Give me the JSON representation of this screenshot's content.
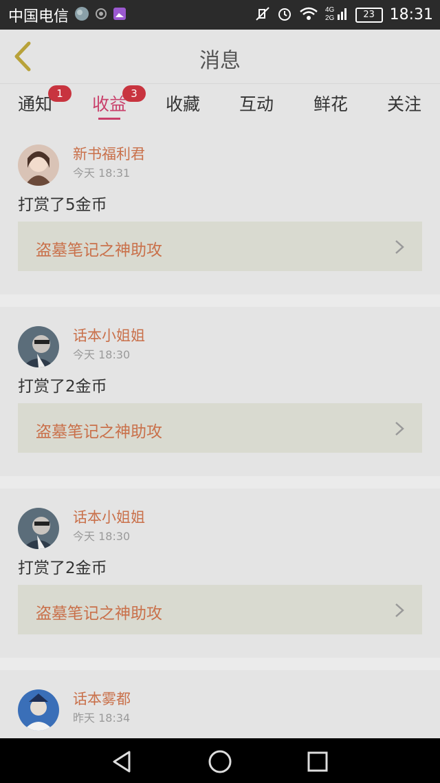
{
  "statusbar": {
    "carrier": "中国电信",
    "battery": "23",
    "time": "18:31",
    "network": "4G 2G"
  },
  "header": {
    "title": "消息"
  },
  "tabs": [
    {
      "label": "通知",
      "badge": "1",
      "active": false
    },
    {
      "label": "收益",
      "badge": "3",
      "active": true
    },
    {
      "label": "收藏",
      "badge": null,
      "active": false
    },
    {
      "label": "互动",
      "badge": null,
      "active": false
    },
    {
      "label": "鲜花",
      "badge": null,
      "active": false
    },
    {
      "label": "关注",
      "badge": null,
      "active": false
    }
  ],
  "messages": [
    {
      "name": "新书福利君",
      "time": "今天 18:31",
      "text": "打赏了5金币",
      "book": "盗墓笔记之神助攻"
    },
    {
      "name": "话本小姐姐",
      "time": "今天 18:30",
      "text": "打赏了2金币",
      "book": "盗墓笔记之神助攻"
    },
    {
      "name": "话本小姐姐",
      "time": "今天 18:30",
      "text": "打赏了2金币",
      "book": "盗墓笔记之神助攻"
    },
    {
      "name": "话本雾都",
      "time": "昨天 18:34",
      "text": "",
      "book": ""
    }
  ],
  "colors": {
    "accent": "#c93f6a",
    "name": "#c9704a",
    "badge": "#c8343f"
  },
  "icons": [
    "back-chevron-icon",
    "mute-icon",
    "alarm-icon",
    "wifi-icon",
    "signal-icon",
    "chevron-right-icon",
    "nav-back-icon",
    "nav-home-icon",
    "nav-recent-icon"
  ]
}
